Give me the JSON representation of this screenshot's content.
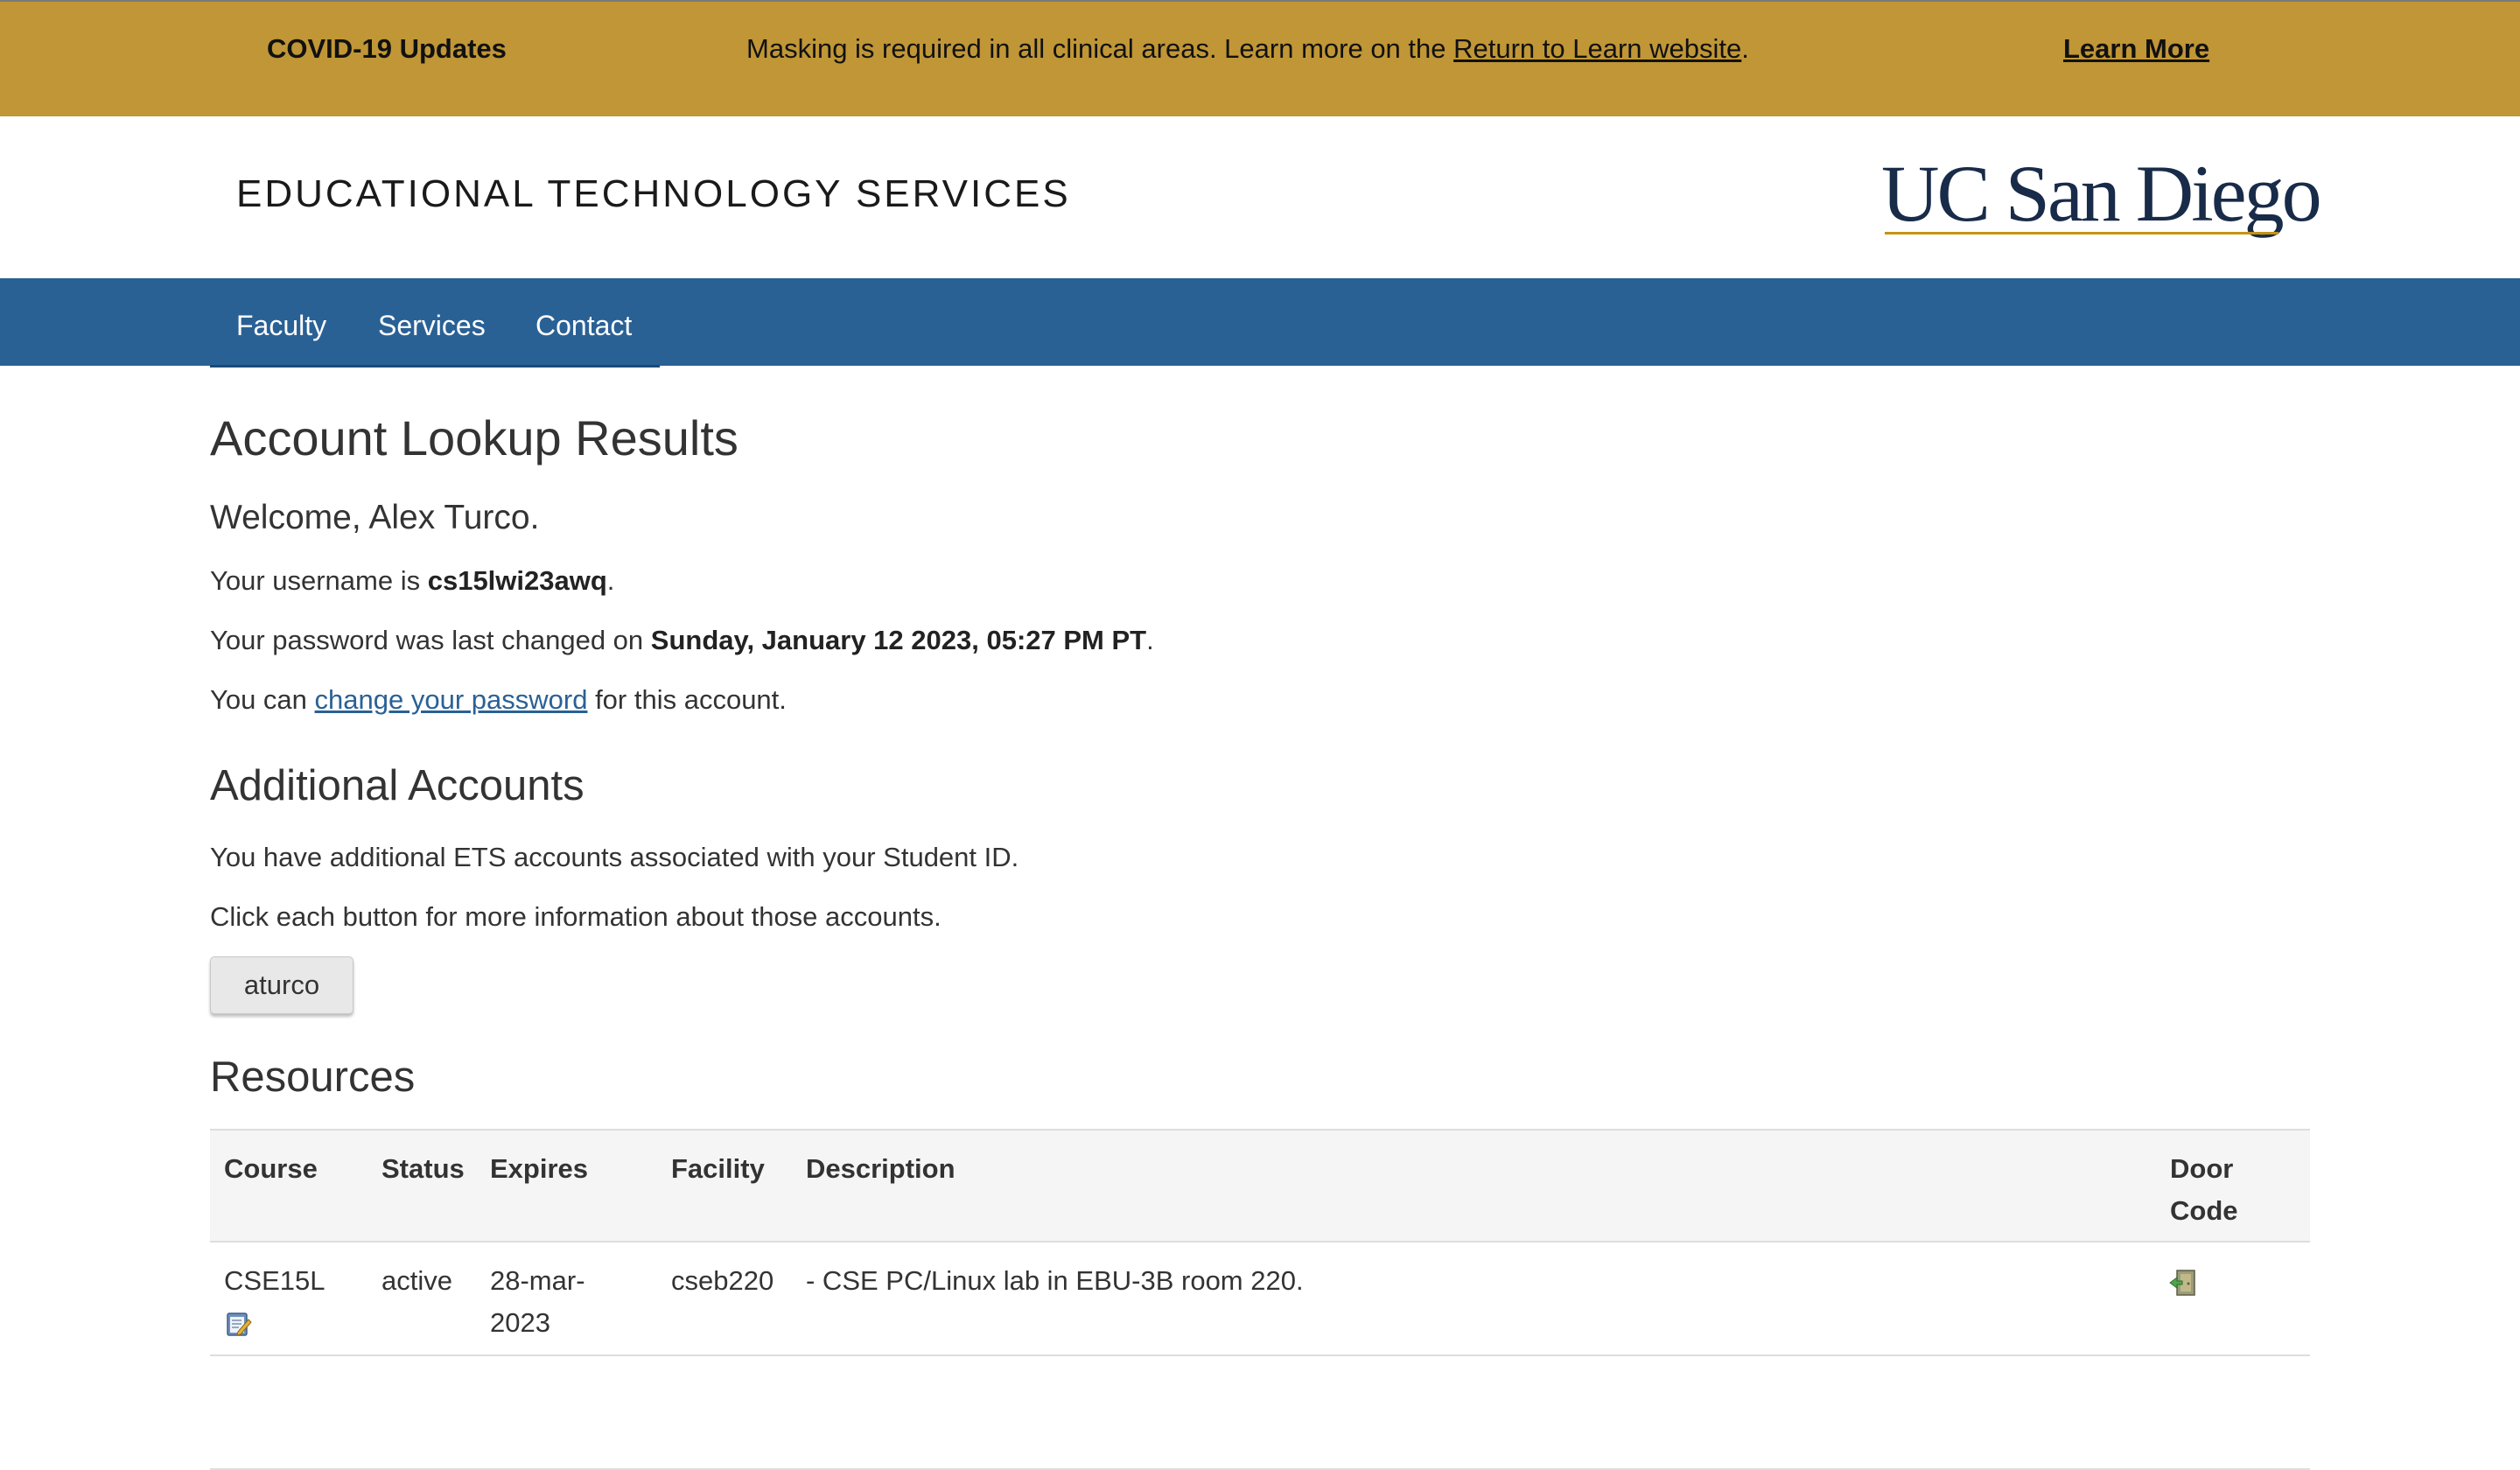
{
  "banner": {
    "title": "COVID-19 Updates",
    "message_before": "Masking is required in all clinical areas. Learn more on the ",
    "link_text": "Return to Learn website",
    "message_after": ".",
    "learn_more": "Learn More",
    "color": "#c09636"
  },
  "header": {
    "site_title": "EDUCATIONAL TECHNOLOGY SERVICES",
    "logo_text": "UC San Diego",
    "logo_color": "#182b49"
  },
  "nav": {
    "color": "#2a6195",
    "items": [
      {
        "label": "Faculty"
      },
      {
        "label": "Services"
      },
      {
        "label": "Contact"
      }
    ]
  },
  "main": {
    "title": "Account Lookup Results",
    "welcome": "Welcome, Alex Turco.",
    "username_prefix": "Your username is ",
    "username": "cs15lwi23awq",
    "username_suffix": ".",
    "password_prefix": "Your password was last changed on ",
    "password_changed": "Sunday, January 12 2023, 05:27 PM PT",
    "password_suffix": ".",
    "change_prefix": "You can ",
    "change_link": "change your password",
    "change_suffix": " for this account."
  },
  "additional": {
    "title": "Additional Accounts",
    "line1": "You have additional ETS accounts associated with your Student ID.",
    "line2": "Click each button for more information about those accounts.",
    "accounts": [
      "aturco"
    ]
  },
  "resources": {
    "title": "Resources",
    "columns": {
      "course": "Course",
      "status": "Status",
      "expires": "Expires",
      "facility": "Facility",
      "description": "Description",
      "door_code_1": "Door",
      "door_code_2": "Code"
    },
    "rows": [
      {
        "course": "CSE15L",
        "status": "active",
        "expires_1": "28-mar-",
        "expires_2": "2023",
        "facility": "cseb220",
        "description": "- CSE PC/Linux lab in EBU-3B room 220.",
        "course_icon": "edit-note-icon",
        "door_icon": "door-icon"
      }
    ]
  }
}
